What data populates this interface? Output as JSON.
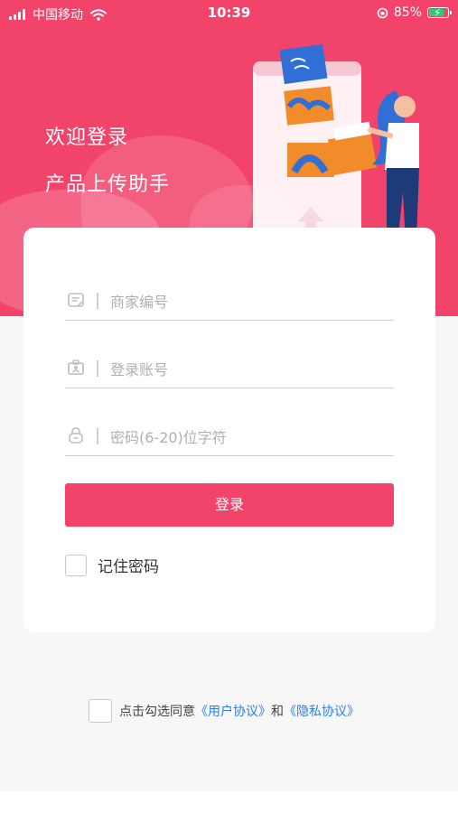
{
  "status_bar": {
    "carrier": "中国移动",
    "time": "10:39",
    "battery_percent": "85%",
    "battery_level": 0.85,
    "icons": [
      "signal-icon",
      "wifi-icon",
      "orientation-lock-icon",
      "battery-icon"
    ]
  },
  "hero": {
    "welcome": "欢迎登录",
    "subtitle": "产品上传助手",
    "illustration": "person-uploading-photos",
    "background_color": "#f2436b"
  },
  "form": {
    "merchant_placeholder": "商家编号",
    "account_placeholder": "登录账号",
    "password_placeholder": "密码(6-20)位字符",
    "login_label": "登录",
    "remember_label": "记住密码",
    "icons": [
      "merchant-icon",
      "account-icon",
      "lock-icon"
    ]
  },
  "agreement": {
    "prefix": "点击勾选同意",
    "user_agreement": "《用户协议》",
    "and": "和",
    "privacy_agreement": "《隐私协议》",
    "link_color": "#2d7ee8"
  }
}
